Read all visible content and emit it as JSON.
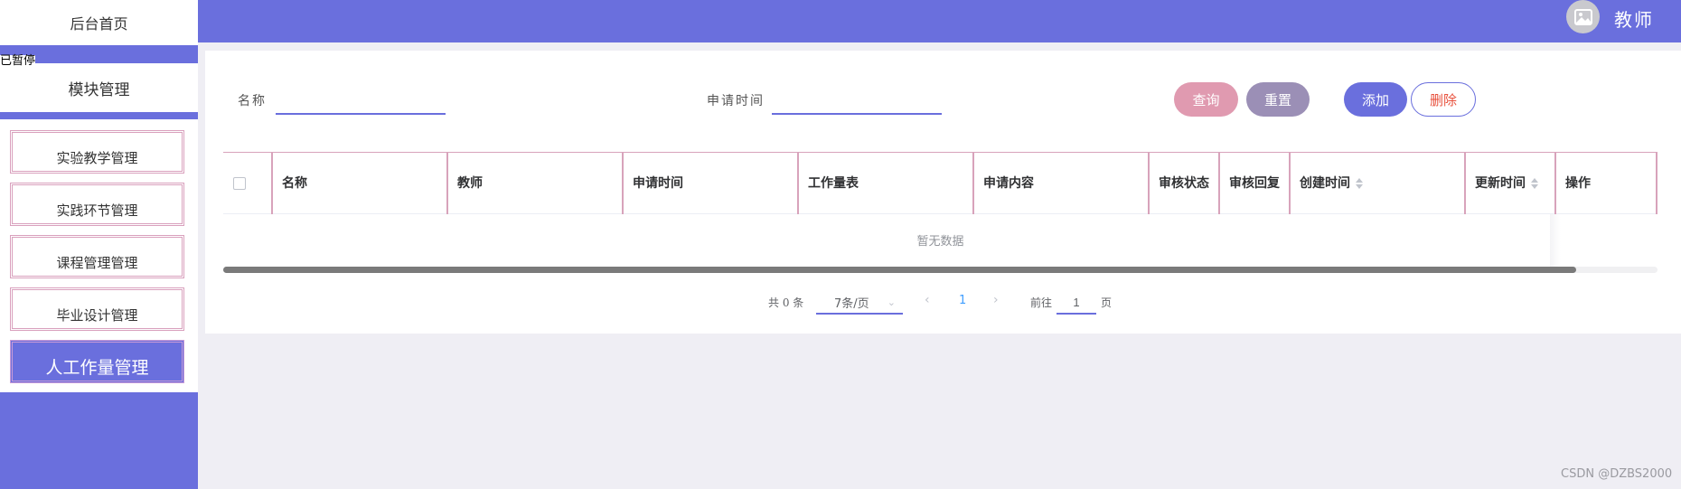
{
  "header": {
    "user_name": "教师",
    "avatar_icon": "image-icon"
  },
  "sidebar": {
    "home_label": "后台首页",
    "module_label": "模块管理",
    "paused_label": "已暂停",
    "items": [
      {
        "label": "实验教学管理",
        "active": false
      },
      {
        "label": "实践环节管理",
        "active": false
      },
      {
        "label": "课程管理管理",
        "active": false
      },
      {
        "label": "毕业设计管理",
        "active": false
      },
      {
        "label": "人工作量管理",
        "active": true
      }
    ]
  },
  "search": {
    "name_label": "名称",
    "name_value": "",
    "date_label": "申请时间",
    "date_value": ""
  },
  "buttons": {
    "query": "查询",
    "reset": "重置",
    "add": "添加",
    "delete": "删除"
  },
  "table": {
    "columns": [
      "名称",
      "教师",
      "申请时间",
      "工作量表",
      "申请内容",
      "审核状态",
      "审核回复",
      "创建时间",
      "更新时间",
      "操作"
    ],
    "sortable_columns": [
      "创建时间",
      "更新时间"
    ],
    "empty_text": "暂无数据"
  },
  "pagination": {
    "total_text": "共 0 条",
    "page_size": "7条/页",
    "current_page": "1",
    "goto_label": "前往",
    "goto_value": "1",
    "page_suffix": "页"
  },
  "watermark": "CSDN @DZBS2000",
  "colors": {
    "primary": "#6a6fdd",
    "query_button": "#e09ab0",
    "reset_button": "#9b8fb6",
    "delete_text": "#e8513d",
    "table_border": "#d8a3bb"
  }
}
